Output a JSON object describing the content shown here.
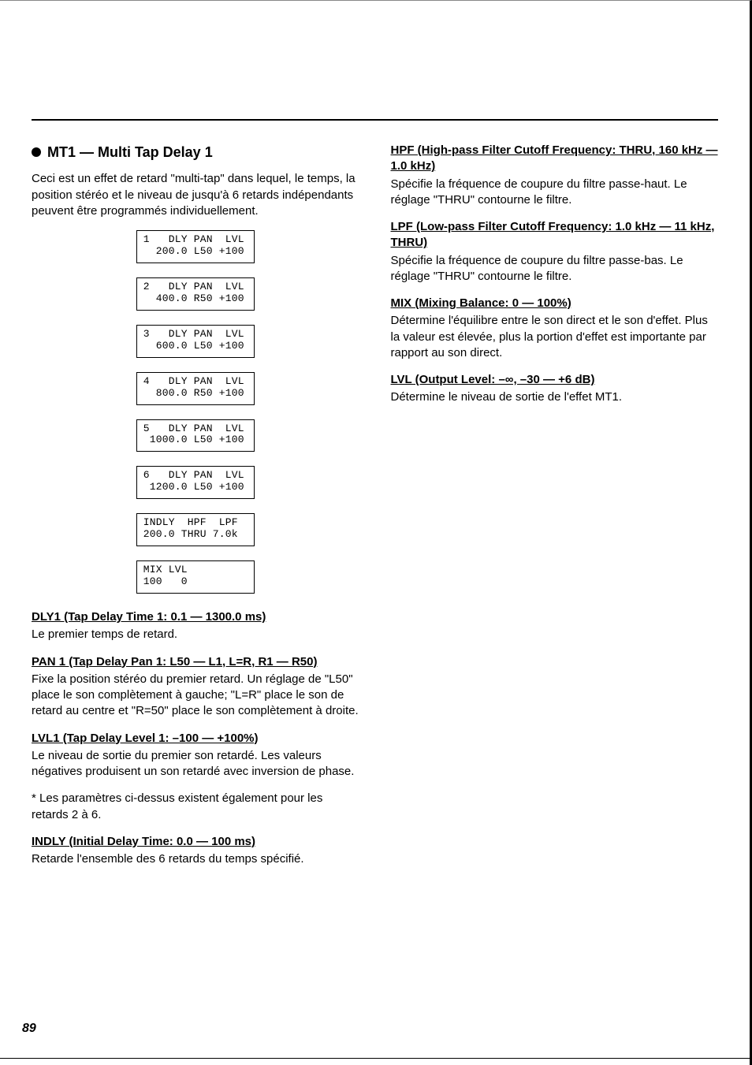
{
  "heading": "MT1 — Multi Tap Delay 1",
  "intro": "Ceci est un effet de retard \"multi-tap\" dans lequel, le temps, la position stéréo et le niveau de jusqu'à 6 retards indépendants peuvent être programmés individuellement.",
  "boxes": [
    "1   DLY PAN  LVL\n  200.0 L50 +100",
    "2   DLY PAN  LVL\n  400.0 R50 +100",
    "3   DLY PAN  LVL\n  600.0 L50 +100",
    "4   DLY PAN  LVL\n  800.0 R50 +100",
    "5   DLY PAN  LVL\n 1000.0 L50 +100",
    "6   DLY PAN  LVL\n 1200.0 L50 +100",
    "INDLY  HPF  LPF\n200.0 THRU 7.0k",
    "MIX LVL\n100   0"
  ],
  "left_params": [
    {
      "h": "DLY1 (Tap Delay Time 1: 0.1 — 1300.0 ms)",
      "b": "Le premier temps de retard."
    },
    {
      "h": "PAN 1 (Tap Delay Pan 1: L50 — L1, L=R, R1 — R50)",
      "b": "Fixe la position stéréo du premier retard. Un réglage de \"L50\" place le son complètement à gauche; \"L=R\" place le son de retard au centre et \"R=50\" place le son complètement à droite."
    },
    {
      "h": "LVL1 (Tap Delay Level 1: –100 — +100%)",
      "b": "Le niveau de sortie du premier son retardé. Les valeurs négatives produisent un son retardé avec inversion de phase."
    }
  ],
  "left_note": "* Les paramètres ci-dessus existent également pour les retards 2 à 6.",
  "left_params2": [
    {
      "h": "INDLY (Initial Delay Time: 0.0 — 100 ms)",
      "b": "Retarde l'ensemble des 6 retards du temps spécifié."
    }
  ],
  "right_params": [
    {
      "h": "HPF (High-pass Filter Cutoff Frequency: THRU, 160 kHz — 1.0 kHz)",
      "b": "Spécifie la fréquence de coupure du filtre passe-haut. Le réglage \"THRU\" contourne le filtre."
    },
    {
      "h": "LPF (Low-pass Filter Cutoff Frequency: 1.0 kHz — 11 kHz, THRU)",
      "b": "Spécifie la fréquence de coupure du filtre passe-bas. Le réglage \"THRU\" contourne le filtre."
    },
    {
      "h": "MIX (Mixing Balance: 0 — 100%)",
      "b": "Détermine l'équilibre entre le son direct et le son d'effet. Plus la valeur est élevée, plus la portion d'effet est importante par rapport au son direct."
    },
    {
      "h": "LVL (Output Level: –∞, –30 — +6 dB)",
      "b": "Détermine le niveau de sortie de l'effet MT1."
    }
  ],
  "page_number": "89"
}
